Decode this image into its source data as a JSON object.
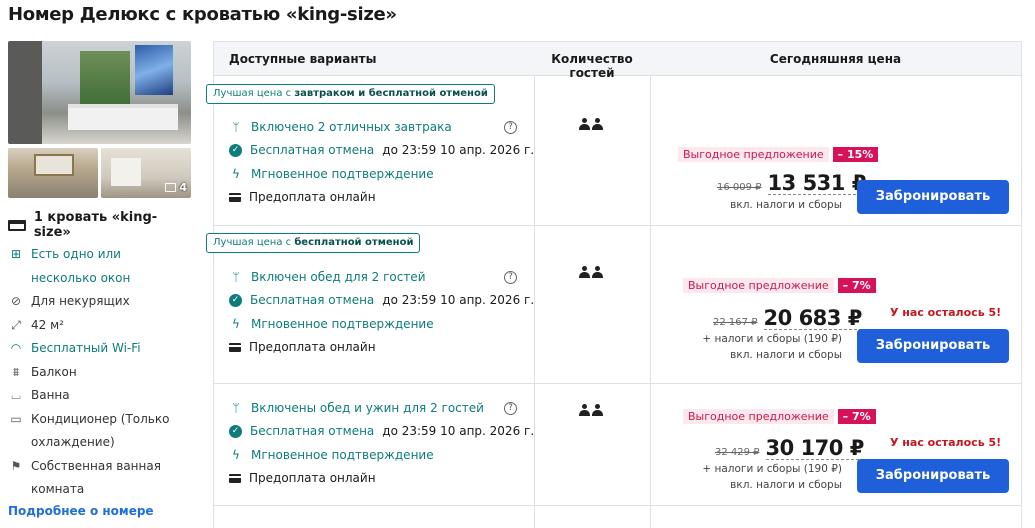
{
  "room": {
    "title": "Номер Делюкс с кроватью «king-size»",
    "photo_count": "4",
    "bed": "1 кровать «king-size»",
    "amenities": [
      {
        "icon": "window-icon",
        "text": "Есть одно или несколько окон",
        "highlight": true
      },
      {
        "icon": "no-smoking-icon",
        "text": "Для некурящих",
        "highlight": false
      },
      {
        "icon": "area-icon",
        "text": "42 м²",
        "highlight": false
      },
      {
        "icon": "wifi-icon",
        "text": "Бесплатный Wi-Fi",
        "highlight": true
      },
      {
        "icon": "balcony-icon",
        "text": "Балкон",
        "highlight": false
      },
      {
        "icon": "bathtub-icon",
        "text": "Ванна",
        "highlight": false
      },
      {
        "icon": "air-conditioner-icon",
        "text": "Кондиционер (Только охлаждение)",
        "highlight": false
      },
      {
        "icon": "shower-icon",
        "text": "Собственная ванная комната",
        "highlight": false
      }
    ],
    "more_link": "Подробнее о номере"
  },
  "table": {
    "headers": [
      "Доступные варианты",
      "Количество гостей",
      "Сегодняшняя цена"
    ]
  },
  "options": [
    {
      "tag_prefix": "Лучшая цена с",
      "tag_bold": "завтраком и бесплатной отменой",
      "meal": "Включено 2 отличных завтрака",
      "cancel_link": "Бесплатная отмена",
      "cancel_rest": "до 23:59 10 апр. 2026 г.",
      "confirm": "Мгновенное подтверждение",
      "prepay": "Предоплата онлайн",
      "deal_label": "Выгодное предложение",
      "discount": "– 15%",
      "old_price": "16 009 ₽",
      "price": "13 531 ₽",
      "extra_tax": "",
      "tax_note": "вкл. налоги и сборы",
      "rooms_left": "",
      "button": "Забронировать"
    },
    {
      "tag_prefix": "Лучшая цена с",
      "tag_bold": "бесплатной отменой",
      "meal": "Включен обед для 2 гостей",
      "cancel_link": "Бесплатная отмена",
      "cancel_rest": "до 23:59 10 апр. 2026 г.",
      "confirm": "Мгновенное подтверждение",
      "prepay": "Предоплата онлайн",
      "deal_label": "Выгодное предложение",
      "discount": "– 7%",
      "old_price": "22 167 ₽",
      "price": "20 683 ₽",
      "extra_tax": "+ налоги и сборы (190 ₽)",
      "tax_note": "вкл. налоги и сборы",
      "rooms_left": "У нас осталось 5!",
      "button": "Забронировать"
    },
    {
      "tag_prefix": "",
      "tag_bold": "",
      "meal": "Включены обед и ужин для 2 гостей",
      "cancel_link": "Бесплатная отмена",
      "cancel_rest": "до 23:59 10 апр. 2026 г.",
      "confirm": "Мгновенное подтверждение",
      "prepay": "Предоплата онлайн",
      "deal_label": "Выгодное предложение",
      "discount": "– 7%",
      "old_price": "32 429 ₽",
      "price": "30 170 ₽",
      "extra_tax": "+ налоги и сборы (190 ₽)",
      "tax_note": "вкл. налоги и сборы",
      "rooms_left": "У нас осталось 5!",
      "button": "Забронировать"
    }
  ],
  "colors": {
    "teal": "#0e7c7b",
    "button": "#1f5fd9",
    "discount": "#d6135a",
    "alert": "#c4161c"
  }
}
